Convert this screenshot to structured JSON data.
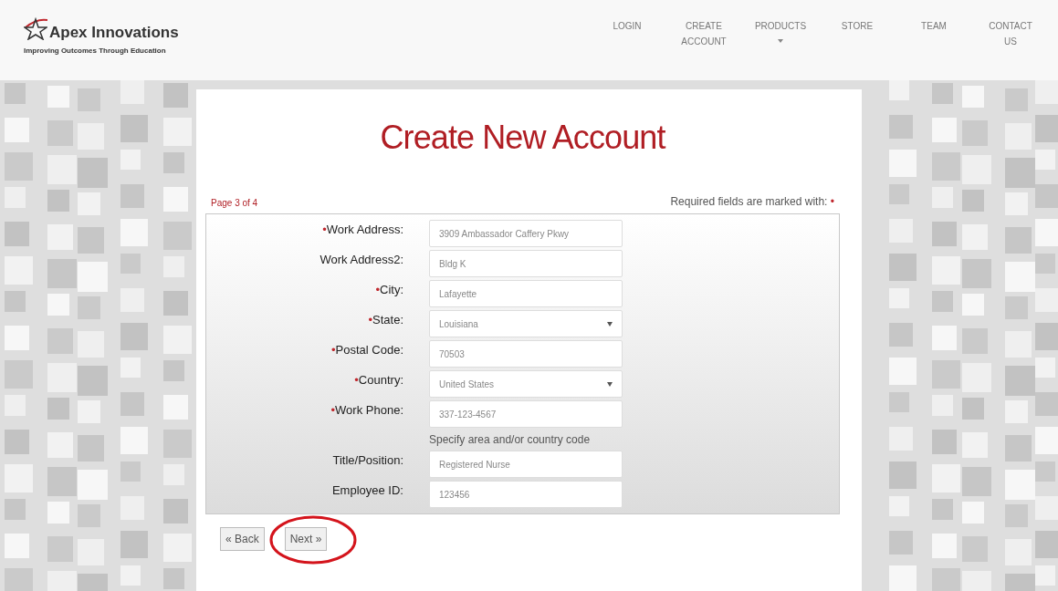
{
  "logo": {
    "name": "Apex Innovations",
    "tagline": "Improving Outcomes Through Education"
  },
  "nav": [
    {
      "label": "LOGIN",
      "dropdown": false
    },
    {
      "label": "CREATE ACCOUNT",
      "dropdown": false
    },
    {
      "label": "PRODUCTS",
      "dropdown": true
    },
    {
      "label": "STORE",
      "dropdown": false
    },
    {
      "label": "TEAM",
      "dropdown": false
    },
    {
      "label": "CONTACT US",
      "dropdown": false
    }
  ],
  "title": "Create New Account",
  "page_indicator": "Page 3 of 4",
  "required_note": "Required fields are marked with:",
  "required_mark": "•",
  "fields": [
    {
      "label": "Work Address:",
      "required": true,
      "kind": "input",
      "value": "3909 Ambassador Caffery Pkwy"
    },
    {
      "label": "Work Address2:",
      "required": false,
      "kind": "input",
      "value": "Bldg K"
    },
    {
      "label": "City:",
      "required": true,
      "kind": "input",
      "value": "Lafayette"
    },
    {
      "label": "State:",
      "required": true,
      "kind": "select",
      "value": "Louisiana"
    },
    {
      "label": "Postal Code:",
      "required": true,
      "kind": "input",
      "value": "70503"
    },
    {
      "label": "Country:",
      "required": true,
      "kind": "select",
      "value": "United States"
    },
    {
      "label": "Work Phone:",
      "required": true,
      "kind": "input",
      "value": "337-123-4567",
      "hint": "Specify area and/or country code"
    },
    {
      "label": "Title/Position:",
      "required": false,
      "kind": "input",
      "value": "Registered Nurse"
    },
    {
      "label": "Employee ID:",
      "required": false,
      "kind": "input",
      "value": "123456"
    }
  ],
  "buttons": [
    {
      "label": "« Back",
      "highlighted": false
    },
    {
      "label": "Next »",
      "highlighted": true
    }
  ]
}
